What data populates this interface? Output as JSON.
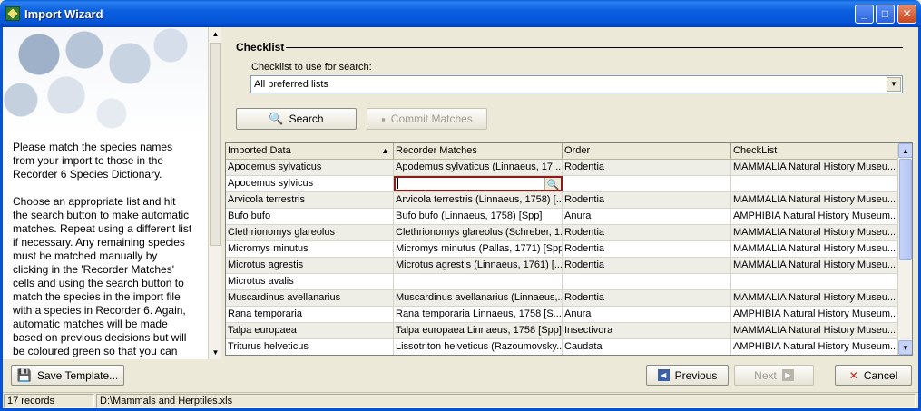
{
  "window": {
    "title": "Import Wizard",
    "controls": {
      "minimize": "_",
      "maximize": "□",
      "close": "✕"
    }
  },
  "left_panel": {
    "paragraphs": [
      "Please match the species names from your import to those in the Recorder 6 Species Dictionary.",
      "Choose an appropriate list and hit the search button to make automatic matches. Repeat using a different list if necessary. Any remaining species must be matched manually by clicking in the 'Recorder Matches' cells and using the search button to match the species in the import file with a species in Recorder 6. Again, automatic matches will be made based on previous decisions but will be coloured green so that you can"
    ]
  },
  "checklist": {
    "group_label": "Checklist",
    "field_label": "Checklist to use for search:",
    "selected_value": "All preferred lists"
  },
  "buttons": {
    "search": "Search",
    "commit": "Commit Matches",
    "save_template": "Save Template...",
    "previous": "Previous",
    "next": "Next",
    "cancel": "Cancel"
  },
  "grid": {
    "columns": [
      "Imported Data",
      "Recorder Matches",
      "Order",
      "CheckList"
    ],
    "rows": [
      [
        "Apodemus sylvaticus",
        "Apodemus sylvaticus (Linnaeus, 17...",
        "Rodentia",
        "MAMMALIA Natural History Museu..."
      ],
      [
        "Apodemus sylvicus",
        "",
        "",
        ""
      ],
      [
        "Arvicola terrestris",
        "Arvicola terrestris (Linnaeus, 1758) [...",
        "Rodentia",
        "MAMMALIA Natural History Museu..."
      ],
      [
        "Bufo bufo",
        "Bufo bufo (Linnaeus, 1758) [Spp]",
        "Anura",
        "AMPHIBIA Natural History Museum..."
      ],
      [
        "Clethrionomys glareolus",
        "Clethrionomys glareolus (Schreber, 1...",
        "Rodentia",
        "MAMMALIA Natural History Museu..."
      ],
      [
        "Micromys minutus",
        "Micromys minutus (Pallas, 1771) [Spp]",
        "Rodentia",
        "MAMMALIA Natural History Museu..."
      ],
      [
        "Microtus agrestis",
        "Microtus agrestis (Linnaeus, 1761) [...",
        "Rodentia",
        "MAMMALIA Natural History Museu..."
      ],
      [
        "Microtus avalis",
        "",
        "",
        ""
      ],
      [
        "Muscardinus avellanarius",
        "Muscardinus avellanarius (Linnaeus,...",
        "Rodentia",
        "MAMMALIA Natural History Museu..."
      ],
      [
        "Rana temporaria",
        "Rana temporaria Linnaeus, 1758 [S...",
        "Anura",
        "AMPHIBIA Natural History Museum..."
      ],
      [
        "Talpa europaea",
        "Talpa europaea Linnaeus, 1758 [Spp]",
        "Insectivora",
        "MAMMALIA Natural History Museu..."
      ],
      [
        "Triturus helveticus",
        "Lissotriton helveticus (Razoumovsky...",
        "Caudata",
        "AMPHIBIA Natural History Museum..."
      ]
    ]
  },
  "status": {
    "records": "17 records",
    "file": "D:\\Mammals and Herptiles.xls"
  }
}
